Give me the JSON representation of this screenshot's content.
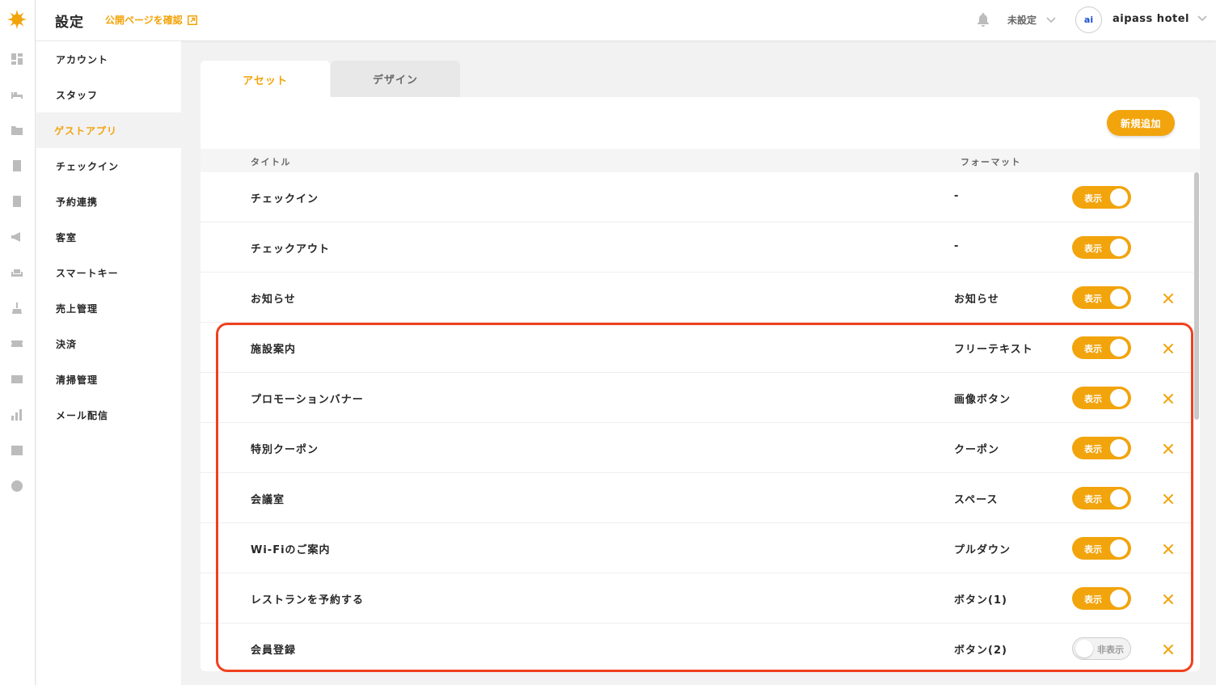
{
  "header": {
    "title": "設定",
    "public_link": "公開ページを確認",
    "status_select": "未設定",
    "avatar_text": "ai",
    "hotel_name": "aipass hotel"
  },
  "rail": {
    "icons": [
      "dashboard-icon",
      "bed-icon",
      "contact-card-icon",
      "door-icon",
      "calculator-icon",
      "megaphone-icon",
      "sofa-icon",
      "cleaning-icon",
      "ticket-icon",
      "mail-icon",
      "bar-chart-icon",
      "news-icon",
      "clock-icon"
    ]
  },
  "sidebar": {
    "items": [
      {
        "label": "アカウント",
        "active": false
      },
      {
        "label": "スタッフ",
        "active": false
      },
      {
        "label": "ゲストアプリ",
        "active": true
      },
      {
        "label": "チェックイン",
        "active": false
      },
      {
        "label": "予約連携",
        "active": false
      },
      {
        "label": "客室",
        "active": false
      },
      {
        "label": "スマートキー",
        "active": false
      },
      {
        "label": "売上管理",
        "active": false
      },
      {
        "label": "決済",
        "active": false
      },
      {
        "label": "清掃管理",
        "active": false
      },
      {
        "label": "メール配信",
        "active": false
      }
    ]
  },
  "tabs": [
    {
      "label": "アセット",
      "active": true
    },
    {
      "label": "デザイン",
      "active": false
    }
  ],
  "add_button": "新規追加",
  "table": {
    "headers": {
      "title": "タイトル",
      "format": "フォーマット"
    },
    "rows": [
      {
        "title": "チェックイン",
        "format": "-",
        "visible": true,
        "toggle_label": "表示",
        "deletable": false
      },
      {
        "title": "チェックアウト",
        "format": "-",
        "visible": true,
        "toggle_label": "表示",
        "deletable": false
      },
      {
        "title": "お知らせ",
        "format": "お知らせ",
        "visible": true,
        "toggle_label": "表示",
        "deletable": true
      },
      {
        "title": "施設案内",
        "format": "フリーテキスト",
        "visible": true,
        "toggle_label": "表示",
        "deletable": true
      },
      {
        "title": "プロモーションバナー",
        "format": "画像ボタン",
        "visible": true,
        "toggle_label": "表示",
        "deletable": true
      },
      {
        "title": "特別クーポン",
        "format": "クーポン",
        "visible": true,
        "toggle_label": "表示",
        "deletable": true
      },
      {
        "title": "会議室",
        "format": "スペース",
        "visible": true,
        "toggle_label": "表示",
        "deletable": true
      },
      {
        "title": "Wi-Fiのご案内",
        "format": "プルダウン",
        "visible": true,
        "toggle_label": "表示",
        "deletable": true
      },
      {
        "title": "レストランを予約する",
        "format": "ボタン(1)",
        "visible": true,
        "toggle_label": "表示",
        "deletable": true
      },
      {
        "title": "会員登録",
        "format": "ボタン(2)",
        "visible": false,
        "toggle_label": "非表示",
        "deletable": true
      }
    ]
  },
  "colors": {
    "accent": "#f2a40c",
    "highlight": "#f0401f",
    "text": "#272727"
  }
}
